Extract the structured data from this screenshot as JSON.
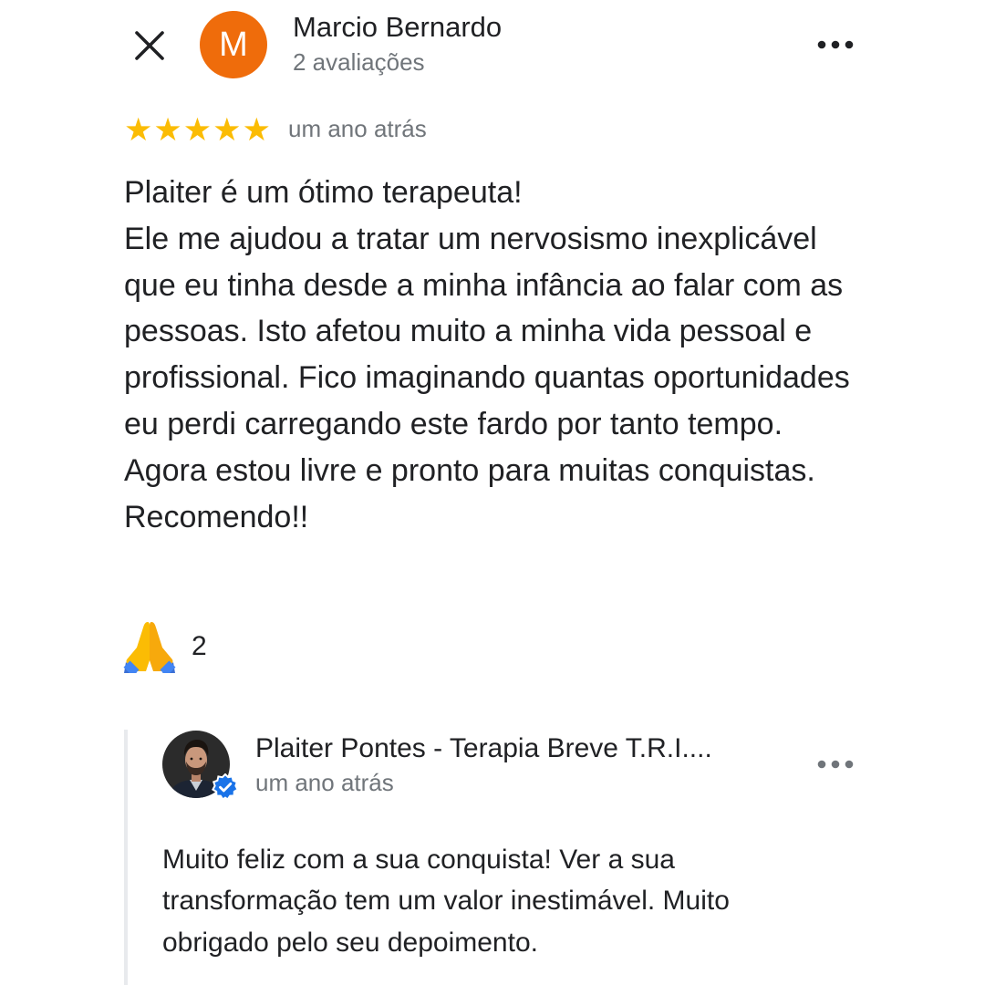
{
  "header": {
    "avatar_letter": "M",
    "avatar_color": "#ef6c0b",
    "reviewer_name": "Marcio Bernardo",
    "reviewer_reviews": "2 avaliações",
    "close_icon": "close-icon",
    "more_icon": "more-horizontal-icon"
  },
  "review": {
    "rating": 5,
    "rating_max": 5,
    "star_color": "#fbbc04",
    "time": "um ano atrás",
    "text": "Plaiter é um ótimo terapeuta!\nEle me ajudou a tratar um nervosismo inexplicável que eu tinha desde a minha infância ao falar com as pessoas. Isto afetou muito a minha vida pessoal e profissional. Fico imaginando quantas oportunidades eu perdi carregando este fardo por tanto tempo. Agora estou livre e pronto para muitas conquistas.\nRecomendo!!"
  },
  "reaction": {
    "icon": "folded-hands-icon",
    "count": "2"
  },
  "owner_reply": {
    "name": "Plaiter Pontes - Terapia Breve T.R.I....",
    "time": "um ano atrás",
    "verified": true,
    "verified_color": "#1a73e8",
    "text": "Muito feliz com a sua conquista! Ver a sua transformação tem um valor inestimável. Muito obrigado pelo seu depoimento."
  }
}
